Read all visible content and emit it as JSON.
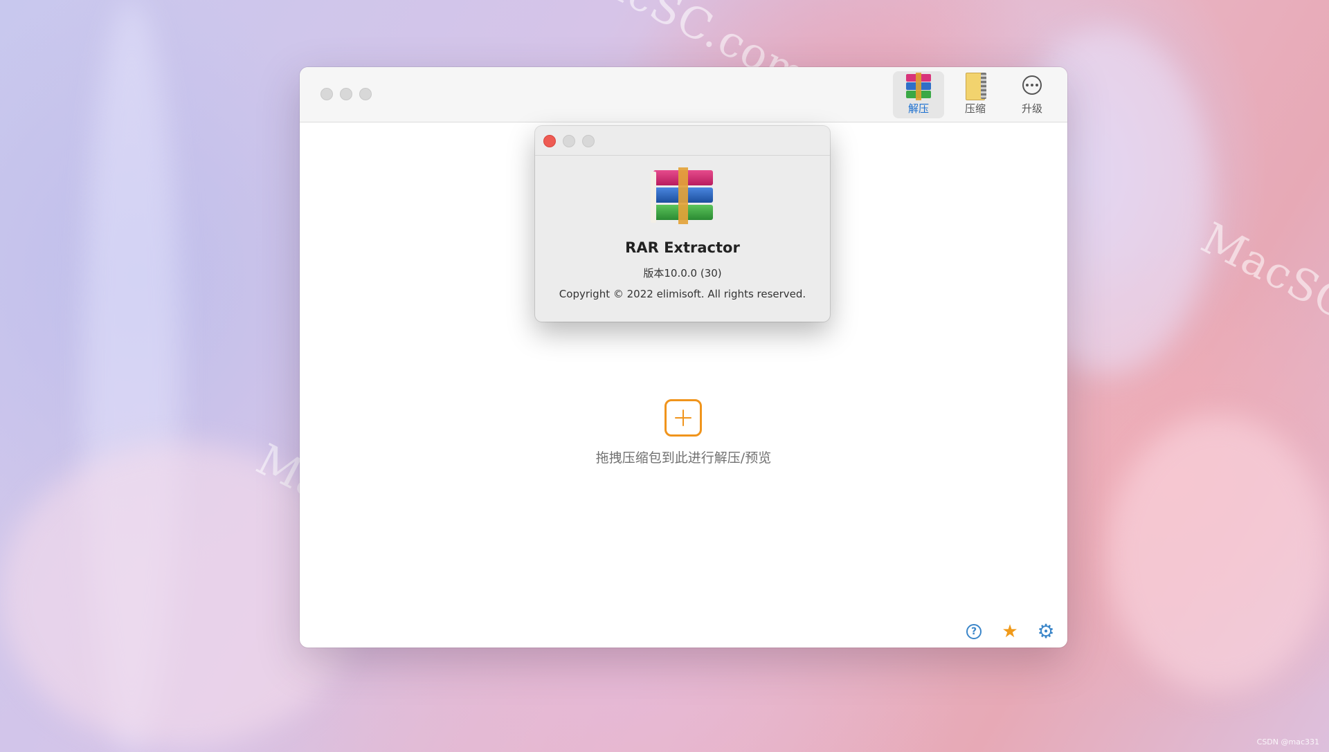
{
  "desktop": {
    "watermark_text": "MacSC.com",
    "credit": "CSDN @mac331"
  },
  "main_window": {
    "toolbar": {
      "extract_label": "解压",
      "compress_label": "压缩",
      "upgrade_label": "升级"
    },
    "drop_hint": "拖拽压缩包到此进行解压/预览",
    "footer": {
      "help_glyph": "?",
      "star_glyph": "★",
      "gear_glyph": "⚙"
    }
  },
  "about_panel": {
    "app_name": "RAR Extractor",
    "version": "版本10.0.0 (30)",
    "copyright": "Copyright © 2022 elimisoft. All rights reserved."
  },
  "colors": {
    "accent_orange": "#f0941c",
    "active_tab_blue": "#1a6fd0",
    "close_red": "#ee5b53"
  }
}
